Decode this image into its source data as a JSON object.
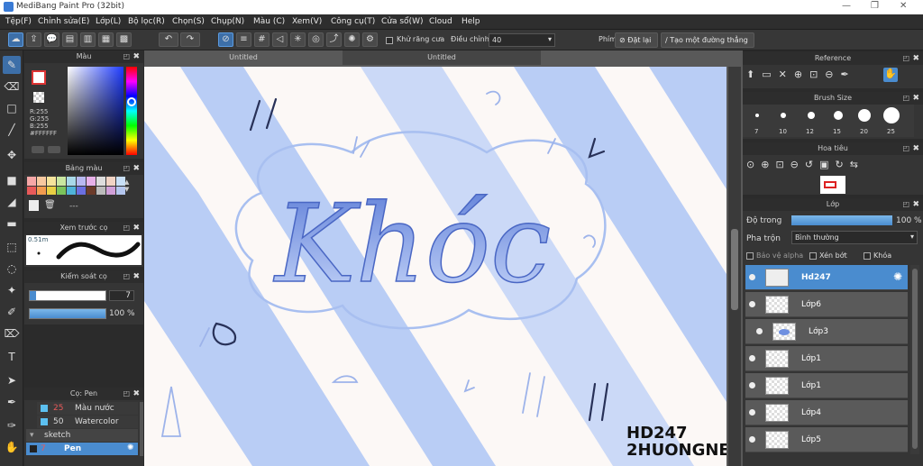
{
  "app": {
    "title": "MediBang Paint Pro (32bit)"
  },
  "menu": [
    "Tệp(F)",
    "Chỉnh sửa(E)",
    "Lớp(L)",
    "Bộ lọc(R)",
    "Chọn(S)",
    "Chụp(N)",
    "Màu (C)",
    "Xem(V)",
    "Công cụ(T)",
    "Cửa sổ(W)",
    "Cloud",
    "Help"
  ],
  "toolbar": {
    "antialias_label": "Khử răng cưa",
    "adjust_label": "Điều chỉnh",
    "adjust_value": "40",
    "phim_label": "Phím",
    "reset_label": "Đặt lại",
    "straight_label": "Tạo một đường thẳng"
  },
  "tabs": {
    "tab1": "Untitled",
    "tab2": "Untitled"
  },
  "color_panel": {
    "title": "Màu",
    "r": "R:255",
    "g": "G:255",
    "b": "B:255",
    "hex": "#FFFFFF"
  },
  "palette_panel": {
    "title": "Bảng màu",
    "dashes": "---"
  },
  "brush_preview_panel": {
    "title": "Xem trước cọ",
    "size": "0.51m"
  },
  "brush_control_panel": {
    "title": "Kiểm soát cọ",
    "size_value": "7",
    "opacity_value": "100 %"
  },
  "brush_list_panel": {
    "title": "Cọ: Pen",
    "items": [
      {
        "size": "25",
        "name": "Màu nước"
      },
      {
        "size": "50",
        "name": "Watercolor"
      }
    ],
    "group": "sketch",
    "selected": {
      "size": "7",
      "name": "Pen"
    }
  },
  "reference_panel": {
    "title": "Reference"
  },
  "brush_size_panel": {
    "title": "Brush Size",
    "sizes": [
      "7",
      "10",
      "12",
      "15",
      "20",
      "25"
    ]
  },
  "navigator_panel": {
    "title": "Hoa tiêu"
  },
  "layer_panel": {
    "title": "Lớp",
    "opacity_label": "Độ trong",
    "opacity_value": "100 %",
    "blend_label": "Pha trộn",
    "blend_value": "Bình thường",
    "protect_alpha": "Bảo vệ alpha",
    "clip": "Xén bớt",
    "lock": "Khóa",
    "layers": [
      {
        "name": "Hd247"
      },
      {
        "name": "Lớp6"
      },
      {
        "name": "Lớp3"
      },
      {
        "name": "Lớp1"
      },
      {
        "name": "Lớp1"
      },
      {
        "name": "Lớp4"
      },
      {
        "name": "Lớp5"
      }
    ]
  },
  "artwork": {
    "text": "Khóc",
    "signature_line1": "HD247",
    "signature_line2": "2HUONGNE"
  },
  "colors": {
    "accent": "#4a8ccf",
    "stripe": "#b9cdf5",
    "stripe_light": "#d4e0f8",
    "ink": "#1c2540"
  }
}
